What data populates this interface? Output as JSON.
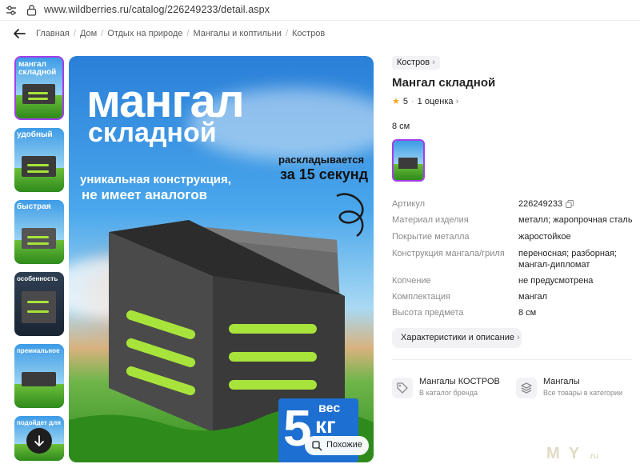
{
  "browser": {
    "url": "www.wildberries.ru/catalog/226249233/detail.aspx"
  },
  "breadcrumbs": [
    "Главная",
    "Дом",
    "Отдых на природе",
    "Мангалы и коптильни",
    "Костров"
  ],
  "gallery": {
    "thumbnails": [
      {
        "caption": "мангал складной",
        "selected": true
      },
      {
        "caption": "удобный",
        "selected": false
      },
      {
        "caption": "быстрая",
        "selected": false
      },
      {
        "caption": "особенность",
        "selected": false
      },
      {
        "caption": "премиальное",
        "selected": false
      },
      {
        "caption": "подойдет для",
        "selected": false
      }
    ],
    "scroll_down_icon": "arrow-down-icon"
  },
  "hero": {
    "title_line1": "мангал",
    "title_line2": "складной",
    "sub_line1": "уникальная конструкция,",
    "sub_line2": "не имеет аналогов",
    "right_line1": "раскладывается",
    "right_line2": "за 15 секунд",
    "weight_number": "5",
    "weight_top": "вес",
    "weight_unit": "кг",
    "similar_label": "Похожие"
  },
  "product": {
    "brand": "Костров",
    "title": "Мангал складной",
    "rating_value": "5",
    "reviews_label": "1 оценка",
    "size_label": "8 см"
  },
  "specs": [
    {
      "key": "Артикул",
      "value": "226249233"
    },
    {
      "key": "Материал изделия",
      "value": "металл; жаропрочная сталь"
    },
    {
      "key": "Покрытие металла",
      "value": "жаростойкое"
    },
    {
      "key": "Конструкция мангала/гриля",
      "value": "переносная; разборная; мангал-дипломат"
    },
    {
      "key": "Копчение",
      "value": "не предусмотрена"
    },
    {
      "key": "Комплектация",
      "value": "мангал"
    },
    {
      "key": "Высота предмета",
      "value": "8 см"
    }
  ],
  "characteristics_button": "Характеристики и описание",
  "catalog_links": [
    {
      "title": "Мангалы КОСТРОВ",
      "subtitle": "В каталог бренда",
      "icon": "tag-icon"
    },
    {
      "title": "Мангалы",
      "subtitle": "Все товары в категории",
      "icon": "layers-icon"
    }
  ],
  "colors": {
    "accent": "#a23ee9",
    "star": "#f5a623",
    "chip_bg": "#f2f2f5"
  }
}
